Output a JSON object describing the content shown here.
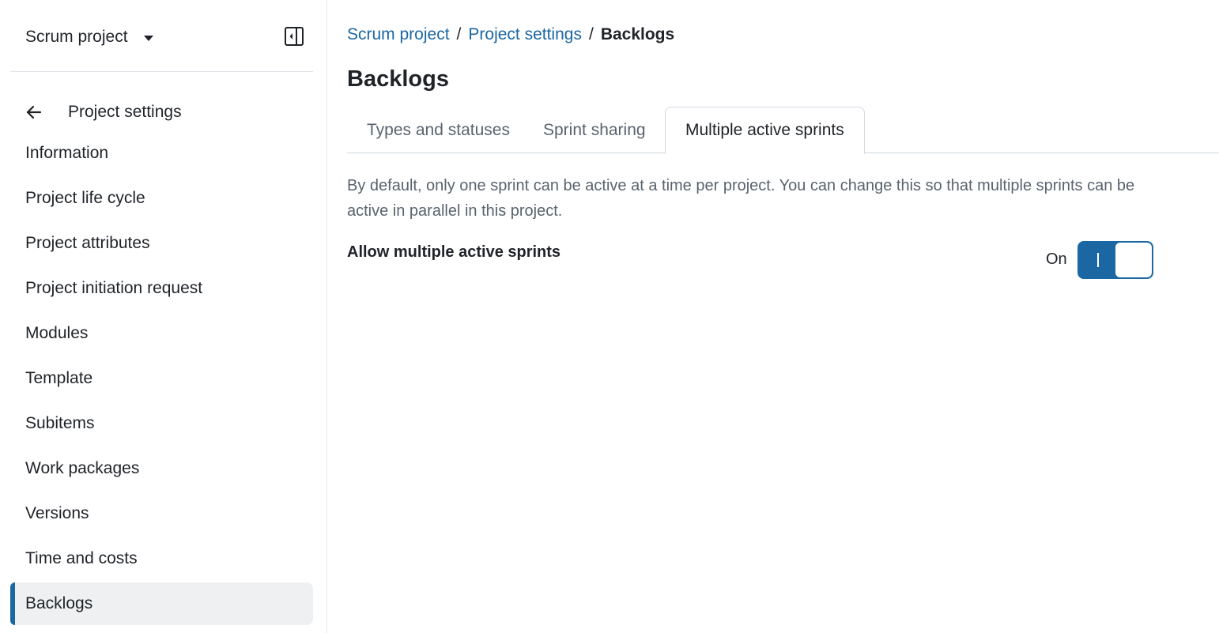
{
  "sidebar": {
    "project_name": "Scrum project",
    "back_label": "Project settings",
    "items": [
      {
        "label": "Information"
      },
      {
        "label": "Project life cycle"
      },
      {
        "label": "Project attributes"
      },
      {
        "label": "Project initiation request"
      },
      {
        "label": "Modules"
      },
      {
        "label": "Template"
      },
      {
        "label": "Subitems"
      },
      {
        "label": "Work packages"
      },
      {
        "label": "Versions"
      },
      {
        "label": "Time and costs"
      },
      {
        "label": "Backlogs"
      }
    ],
    "active_item": "Backlogs"
  },
  "breadcrumb": {
    "items": [
      "Scrum project",
      "Project settings"
    ],
    "separator": "/",
    "current": "Backlogs"
  },
  "page": {
    "title": "Backlogs"
  },
  "tabs": [
    {
      "label": "Types and statuses"
    },
    {
      "label": "Sprint sharing"
    },
    {
      "label": "Multiple active sprints"
    }
  ],
  "active_tab": "Multiple active sprints",
  "content": {
    "description": "By default, only one sprint can be active at a time per project. You can change this so that multiple sprints can be active in parallel in this project.",
    "setting_label": "Allow multiple active sprints",
    "toggle_state_label": "On",
    "toggle_on": true
  },
  "colors": {
    "accent": "#1a67a3",
    "active_bg": "#eef0f2",
    "muted_text": "#59636e"
  },
  "icons": {
    "project_caret": "caret-down-icon",
    "collapse": "sidebar-collapse-icon",
    "back": "arrow-left-icon"
  }
}
